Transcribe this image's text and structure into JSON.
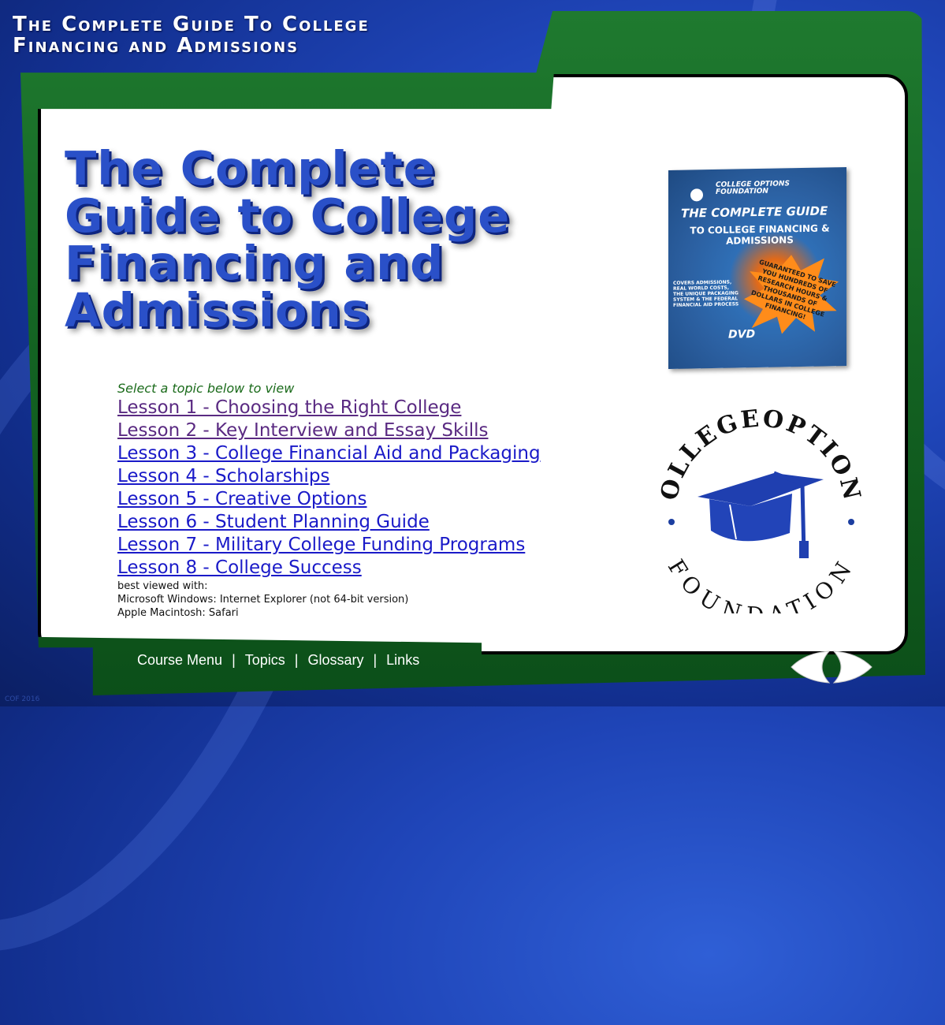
{
  "header": {
    "title_line1": "The Complete Guide To College",
    "title_line2": "Financing and Admissions"
  },
  "main": {
    "title_line1": "The Complete",
    "title_line2": "Guide to College",
    "title_line3": "Financing and",
    "title_line4": "Admissions"
  },
  "dvd_cover": {
    "brand": "COLLEGE OPTIONS FOUNDATION",
    "title1": "THE COMPLETE GUIDE",
    "title2": "TO COLLEGE FINANCING & ADMISSIONS",
    "burst": "GUARANTEED TO SAVE YOU HUNDREDS OF RESEARCH HOURS & THOUSANDS OF DOLLARS IN COLLEGE FINANCING!",
    "side_text": "COVERS ADMISSIONS, REAL WORLD COSTS, THE UNIQUE PACKAGING SYSTEM & THE FEDERAL FINANCIAL AID PROCESS",
    "format_logo": "DVD"
  },
  "lessons": {
    "prompt": "Select a topic below to view",
    "items": [
      {
        "label": "Lesson 1 - Choosing the Right College",
        "visited": true
      },
      {
        "label": "Lesson 2 - Key Interview and Essay Skills",
        "visited": true
      },
      {
        "label": "Lesson 3 - College Financial Aid and Packaging",
        "visited": false
      },
      {
        "label": "Lesson 4 - Scholarships",
        "visited": false
      },
      {
        "label": "Lesson 5 - Creative Options",
        "visited": false
      },
      {
        "label": "Lesson 6 - Student Planning Guide",
        "visited": false
      },
      {
        "label": "Lesson 7 - Military College Funding Programs",
        "visited": false
      },
      {
        "label": "Lesson 8 - College Success",
        "visited": false
      }
    ],
    "note_line1": "best viewed with:",
    "note_line2": "Microsoft Windows: Internet Explorer (not 64-bit version)",
    "note_line3": "Apple Macintosh: Safari"
  },
  "seal": {
    "top_text": "COLLEGEOPTIONS",
    "bottom_text": "FOUNDATION"
  },
  "nav": {
    "course_menu": "Course Menu",
    "topics": "Topics",
    "glossary": "Glossary",
    "links": "Links",
    "separator": "|"
  },
  "footer": {
    "copyright": "COF 2016"
  },
  "colors": {
    "background_blue": "#1f45b8",
    "frame_green": "#136222",
    "title_blue": "#2a50c8",
    "link_blue": "#1a1ac8",
    "visited_purple": "#5a2a82",
    "prompt_green": "#1b6b1b",
    "seal_navy": "#1c3ea0"
  },
  "icons": {
    "graduation_cap": "graduation-cap-icon",
    "prev_arrow": "prev-arrow-icon",
    "next_arrow": "next-arrow-icon"
  }
}
